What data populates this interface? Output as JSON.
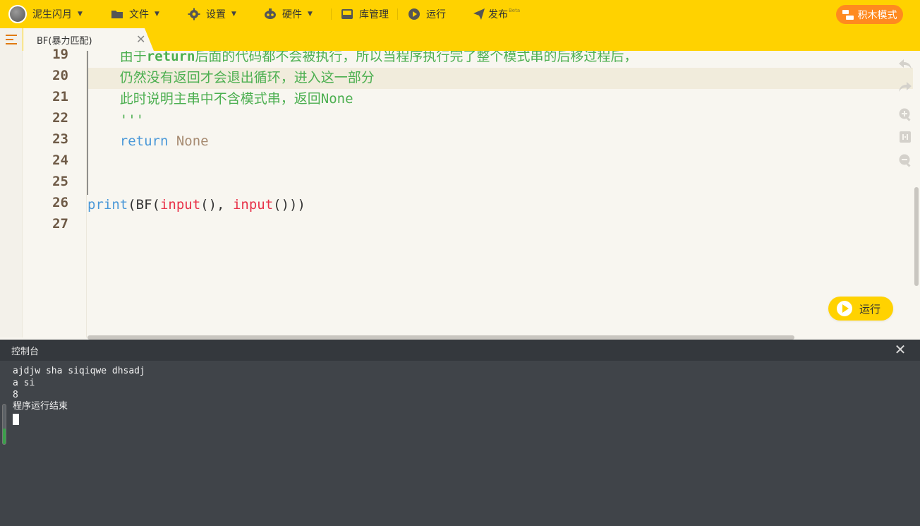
{
  "menubar": {
    "user": "泥生闪月",
    "file": "文件",
    "settings": "设置",
    "hardware": "硬件",
    "library": "库管理",
    "run": "运行",
    "publish": "发布",
    "publish_badge": "Beta",
    "blocks_mode": "积木模式"
  },
  "tab": {
    "title": "BF(暴力匹配)"
  },
  "editor": {
    "line_numbers": [
      "19",
      "20",
      "21",
      "22",
      "23",
      "24",
      "25",
      "26",
      "27"
    ],
    "lines": {
      "l19_a": "    由于",
      "l19_b": "return",
      "l19_c": "后面的代码都不会被执行，所以当程序执行完了整个模式串的后移过程后，",
      "l20": "    仍然没有返回才会退出循环，进入这一部分",
      "l21_a": "    此时说明主串中不含模式串，返回",
      "l21_b": "None",
      "l22": "    '''",
      "l23_kw": "    return",
      "l23_val": " None",
      "l26_print": "print",
      "l26_a": "(BF(",
      "l26_in1": "input",
      "l26_b": "(), ",
      "l26_in2": "input",
      "l26_c": "()))"
    },
    "run_button": "运行"
  },
  "console": {
    "title": "控制台",
    "lines": [
      "ajdjw sha siqiqwe dhsadj",
      "a si",
      "8",
      "程序运行结束"
    ]
  },
  "colors": {
    "accent": "#ffd200",
    "blocks_button": "#ff8a1f",
    "console_bg": "#404449"
  }
}
